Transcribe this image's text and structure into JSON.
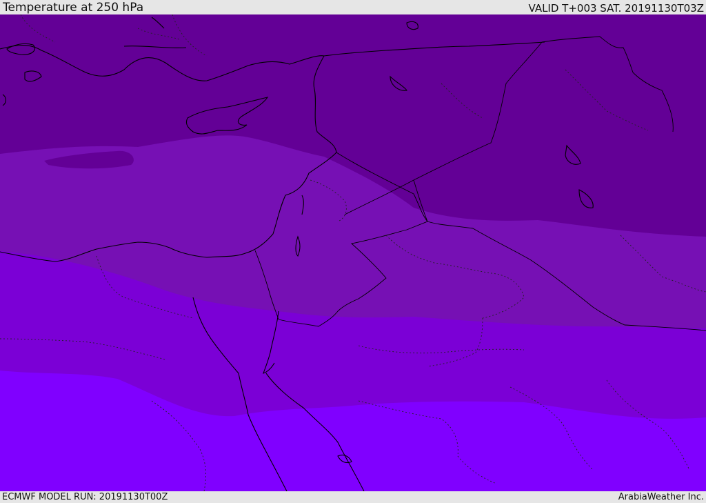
{
  "header": {
    "title": "Temperature at 250 hPa",
    "valid_time": "VALID T+003 SAT. 20191130T03Z"
  },
  "footer": {
    "model_run": "ECMWF MODEL RUN: 20191130T00Z",
    "credit": "ArabiaWeather Inc."
  },
  "map": {
    "field": "temperature",
    "level": "250 hPa",
    "bands": [
      {
        "name": "band-coldest",
        "color": "#630096"
      },
      {
        "name": "band-cold",
        "color": "#7610b4"
      },
      {
        "name": "band-mid",
        "color": "#7b00d6"
      },
      {
        "name": "band-warm",
        "color": "#8000ff"
      }
    ],
    "coastline_color": "#000000",
    "border_style": "dotted"
  }
}
